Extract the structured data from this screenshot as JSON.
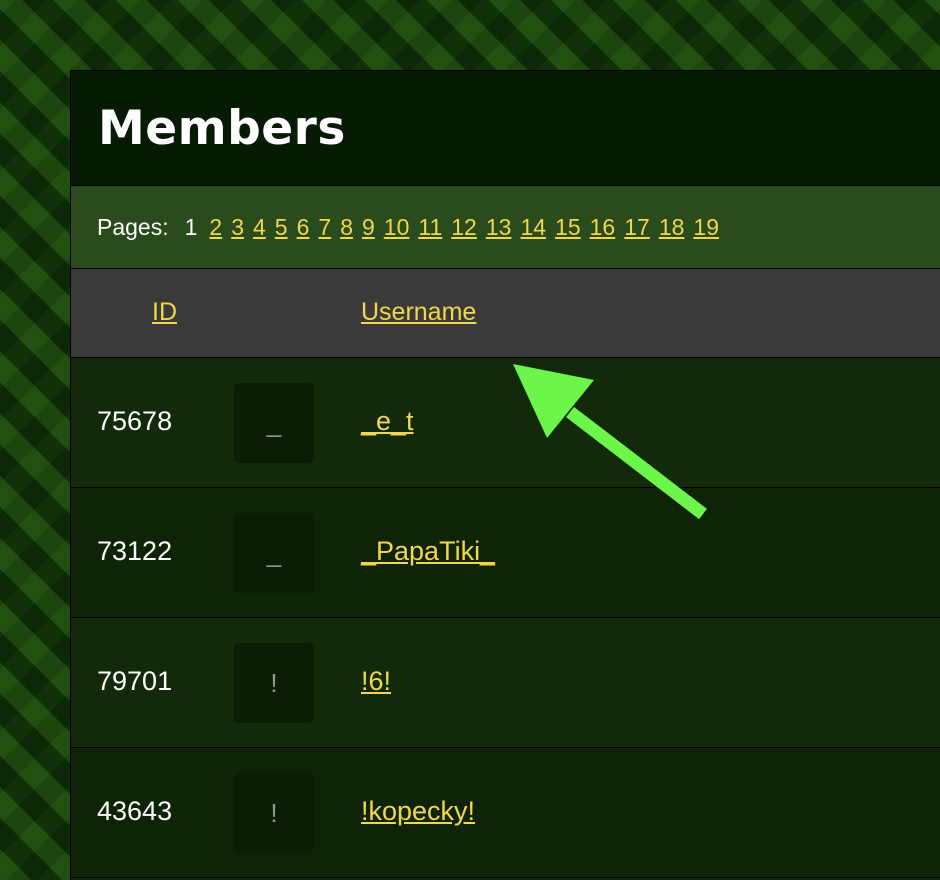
{
  "page": {
    "title": "Members"
  },
  "pagination": {
    "label": "Pages:",
    "current": "1",
    "pages": [
      "2",
      "3",
      "4",
      "5",
      "6",
      "7",
      "8",
      "9",
      "10",
      "11",
      "12",
      "13",
      "14",
      "15",
      "16",
      "17",
      "18",
      "19"
    ]
  },
  "table": {
    "columns": {
      "id": "ID",
      "username": "Username"
    },
    "rows": [
      {
        "id": "75678",
        "avatar": "_",
        "username": "_e_t"
      },
      {
        "id": "73122",
        "avatar": "_",
        "username": "_PapaTiki_"
      },
      {
        "id": "79701",
        "avatar": "!",
        "username": "!6!"
      },
      {
        "id": "43643",
        "avatar": "!",
        "username": "!kopecky!"
      }
    ]
  },
  "colors": {
    "link": "#f2d64b",
    "header_bg": "#071a03",
    "pager_bg": "#2a4b1c",
    "table_head_bg": "#3a3a3a",
    "annotation_arrow": "#6cf54a"
  },
  "annotation": {
    "icon": "arrow-icon"
  }
}
